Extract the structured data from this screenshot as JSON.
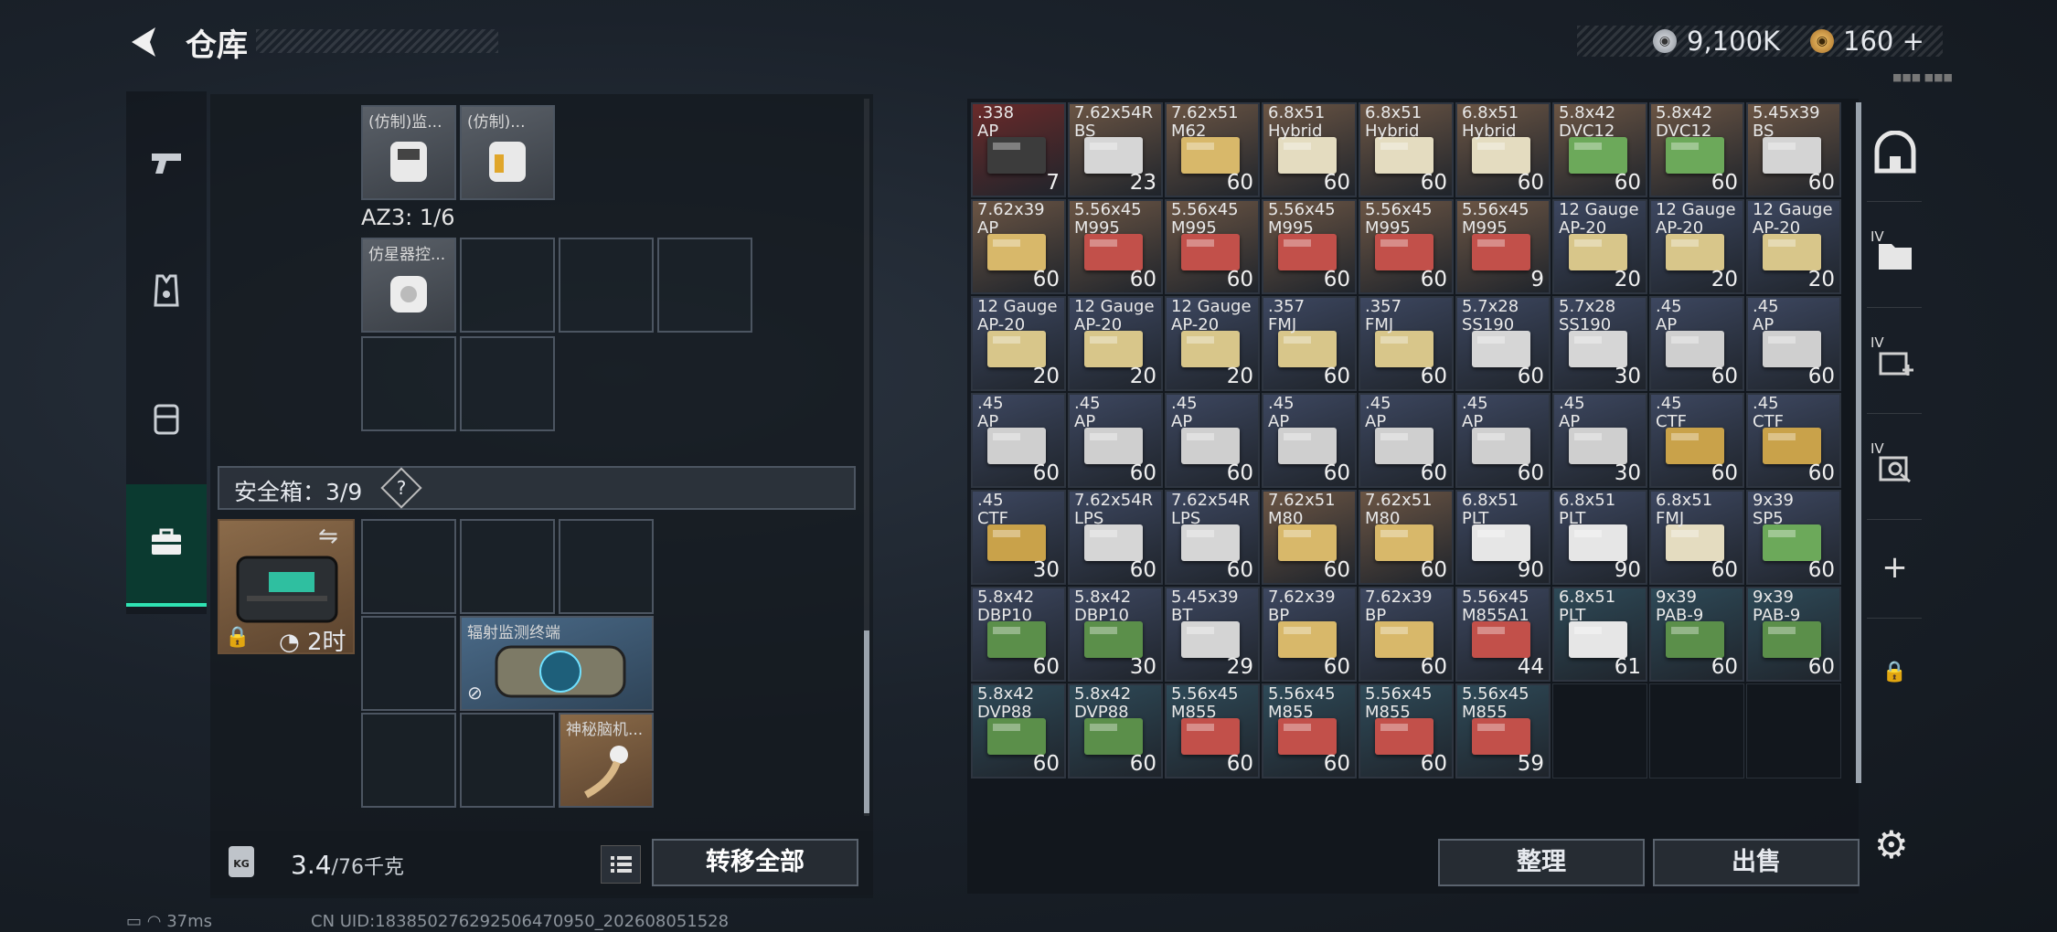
{
  "header": {
    "title": "仓库",
    "coin_silver": "9,100K",
    "coin_gold": "160",
    "gold_plus": "+",
    "small_id": "■■■ ■■■"
  },
  "left_panel": {
    "top_items": [
      {
        "label": "(仿制)监..."
      },
      {
        "label": "(仿制)..."
      }
    ],
    "az3_label": "AZ3: 1/6",
    "az3_item": "仿星器控...",
    "safe_label": "安全箱：3/9",
    "safe_q": "?",
    "safe_timer": "2时",
    "safe_items": [
      {
        "label": "辐射监测终端"
      },
      {
        "label": "神秘脑机..."
      }
    ],
    "weight": "3.4",
    "weight_max": "/76千克",
    "weight_icon": "KG",
    "transfer_label": "转移全部"
  },
  "ammo": [
    {
      "name": ".338\nAP",
      "count": "7",
      "color": "#3c3c3c",
      "bg": "#6a2a2a"
    },
    {
      "name": "7.62x54R\nBS",
      "count": "23",
      "color": "#d6d6d6",
      "bg": "#6b5544"
    },
    {
      "name": "7.62x51\nM62",
      "count": "60",
      "color": "#d8b86a",
      "bg": "#6b5544"
    },
    {
      "name": "6.8x51\nHybrid",
      "count": "60",
      "color": "#e4dcc0",
      "bg": "#6b5544"
    },
    {
      "name": "6.8x51\nHybrid",
      "count": "60",
      "color": "#e4dcc0",
      "bg": "#6b5544"
    },
    {
      "name": "6.8x51\nHybrid",
      "count": "60",
      "color": "#e4dcc0",
      "bg": "#6b5544"
    },
    {
      "name": "5.8x42\nDVC12",
      "count": "60",
      "color": "#6ca95a",
      "bg": "#6b5544"
    },
    {
      "name": "5.8x42\nDVC12",
      "count": "60",
      "color": "#6ca95a",
      "bg": "#6b5544"
    },
    {
      "name": "5.45x39\nBS",
      "count": "60",
      "color": "#d4d4d4",
      "bg": "#6b5544"
    },
    {
      "name": "7.62x39\nAP",
      "count": "60",
      "color": "#d8b86a",
      "bg": "#6b5544"
    },
    {
      "name": "5.56x45\nM995",
      "count": "60",
      "color": "#c2504a",
      "bg": "#6b5544"
    },
    {
      "name": "5.56x45\nM995",
      "count": "60",
      "color": "#c2504a",
      "bg": "#6b5544"
    },
    {
      "name": "5.56x45\nM995",
      "count": "60",
      "color": "#c2504a",
      "bg": "#6b5544"
    },
    {
      "name": "5.56x45\nM995",
      "count": "60",
      "color": "#c2504a",
      "bg": "#6b5544"
    },
    {
      "name": "5.56x45\nM995",
      "count": "9",
      "color": "#c2504a",
      "bg": "#6b5544"
    },
    {
      "name": "12 Gauge\nAP-20",
      "count": "20",
      "color": "#d8c68a",
      "bg": "#3d4760"
    },
    {
      "name": "12 Gauge\nAP-20",
      "count": "20",
      "color": "#d8c68a",
      "bg": "#3d4760"
    },
    {
      "name": "12 Gauge\nAP-20",
      "count": "20",
      "color": "#d8c68a",
      "bg": "#3d4760"
    },
    {
      "name": "12 Gauge\nAP-20",
      "count": "20",
      "color": "#d8c68a",
      "bg": "#3d4760"
    },
    {
      "name": "12 Gauge\nAP-20",
      "count": "20",
      "color": "#d8c68a",
      "bg": "#3d4760"
    },
    {
      "name": "12 Gauge\nAP-20",
      "count": "20",
      "color": "#d8c68a",
      "bg": "#3d4760"
    },
    {
      "name": ".357\nFMJ",
      "count": "60",
      "color": "#d8c68a",
      "bg": "#3d4760"
    },
    {
      "name": ".357\nFMJ",
      "count": "60",
      "color": "#d8c68a",
      "bg": "#3d4760"
    },
    {
      "name": "5.7x28\nSS190",
      "count": "60",
      "color": "#d6d6d6",
      "bg": "#3d4760"
    },
    {
      "name": "5.7x28\nSS190",
      "count": "30",
      "color": "#d6d6d6",
      "bg": "#3d4760"
    },
    {
      "name": ".45\nAP",
      "count": "60",
      "color": "#cfcfcf",
      "bg": "#3d4760"
    },
    {
      "name": ".45\nAP",
      "count": "60",
      "color": "#cfcfcf",
      "bg": "#3d4760"
    },
    {
      "name": ".45\nAP",
      "count": "60",
      "color": "#cfcfcf",
      "bg": "#3d4760"
    },
    {
      "name": ".45\nAP",
      "count": "60",
      "color": "#cfcfcf",
      "bg": "#3d4760"
    },
    {
      "name": ".45\nAP",
      "count": "60",
      "color": "#cfcfcf",
      "bg": "#3d4760"
    },
    {
      "name": ".45\nAP",
      "count": "60",
      "color": "#cfcfcf",
      "bg": "#3d4760"
    },
    {
      "name": ".45\nAP",
      "count": "60",
      "color": "#cfcfcf",
      "bg": "#3d4760"
    },
    {
      "name": ".45\nAP",
      "count": "60",
      "color": "#cfcfcf",
      "bg": "#3d4760"
    },
    {
      "name": ".45\nAP",
      "count": "30",
      "color": "#cfcfcf",
      "bg": "#3d4760"
    },
    {
      "name": ".45\nCTF",
      "count": "60",
      "color": "#c9a24a",
      "bg": "#3d4760"
    },
    {
      "name": ".45\nCTF",
      "count": "60",
      "color": "#c9a24a",
      "bg": "#3d4760"
    },
    {
      "name": ".45\nCTF",
      "count": "30",
      "color": "#c9a24a",
      "bg": "#3d4760"
    },
    {
      "name": "7.62x54R\nLPS",
      "count": "60",
      "color": "#d6d6d6",
      "bg": "#3d4760"
    },
    {
      "name": "7.62x54R\nLPS",
      "count": "60",
      "color": "#d6d6d6",
      "bg": "#3d4760"
    },
    {
      "name": "7.62x51\nM80",
      "count": "60",
      "color": "#d8b86a",
      "bg": "#6b5544"
    },
    {
      "name": "7.62x51\nM80",
      "count": "60",
      "color": "#d8b86a",
      "bg": "#6b5544"
    },
    {
      "name": "6.8x51\nPLT",
      "count": "90",
      "color": "#e6e6e6",
      "bg": "#3d4760"
    },
    {
      "name": "6.8x51\nPLT",
      "count": "90",
      "color": "#e6e6e6",
      "bg": "#3d4760"
    },
    {
      "name": "6.8x51\nFMJ",
      "count": "60",
      "color": "#e4dcc0",
      "bg": "#3d4760"
    },
    {
      "name": "9x39\nSP5",
      "count": "60",
      "color": "#6ca95a",
      "bg": "#3d4760"
    },
    {
      "name": "5.8x42\nDBP10",
      "count": "60",
      "color": "#5b8f4a",
      "bg": "#3d4760"
    },
    {
      "name": "5.8x42\nDBP10",
      "count": "30",
      "color": "#5b8f4a",
      "bg": "#3d4760"
    },
    {
      "name": "5.45x39\nBT",
      "count": "29",
      "color": "#d4d4d4",
      "bg": "#3d4760"
    },
    {
      "name": "7.62x39\nBP",
      "count": "60",
      "color": "#d8b86a",
      "bg": "#3d4760"
    },
    {
      "name": "7.62x39\nBP",
      "count": "60",
      "color": "#d8b86a",
      "bg": "#3d4760"
    },
    {
      "name": "5.56x45\nM855A1",
      "count": "44",
      "color": "#c2504a",
      "bg": "#3d4760"
    },
    {
      "name": "6.8x51\nPLT",
      "count": "61",
      "color": "#e6e6e6",
      "bg": "#2e4a58"
    },
    {
      "name": "9x39\nPAB-9",
      "count": "60",
      "color": "#5b8f4a",
      "bg": "#2e4a58"
    },
    {
      "name": "9x39\nPAB-9",
      "count": "60",
      "color": "#5b8f4a",
      "bg": "#2e4a58"
    },
    {
      "name": "5.8x42\nDVP88",
      "count": "60",
      "color": "#5b8f4a",
      "bg": "#2e4a58"
    },
    {
      "name": "5.8x42\nDVP88",
      "count": "60",
      "color": "#5b8f4a",
      "bg": "#2e4a58"
    },
    {
      "name": "5.56x45\nM855",
      "count": "60",
      "color": "#c2504a",
      "bg": "#2e4a58"
    },
    {
      "name": "5.56x45\nM855",
      "count": "60",
      "color": "#c2504a",
      "bg": "#2e4a58"
    },
    {
      "name": "5.56x45\nM855",
      "count": "60",
      "color": "#c2504a",
      "bg": "#2e4a58"
    },
    {
      "name": "5.56x45\nM855",
      "count": "59",
      "color": "#c2504a",
      "bg": "#2e4a58"
    }
  ],
  "right_buttons": {
    "tidy": "整理",
    "sell": "出售"
  },
  "right_icons": {
    "plus": "+",
    "iv1": "IV",
    "iv2": "IV",
    "iv3": "IV"
  },
  "status": {
    "ping": "37ms",
    "uid": "CN UID:18385027629250647095​0_202608051528"
  }
}
